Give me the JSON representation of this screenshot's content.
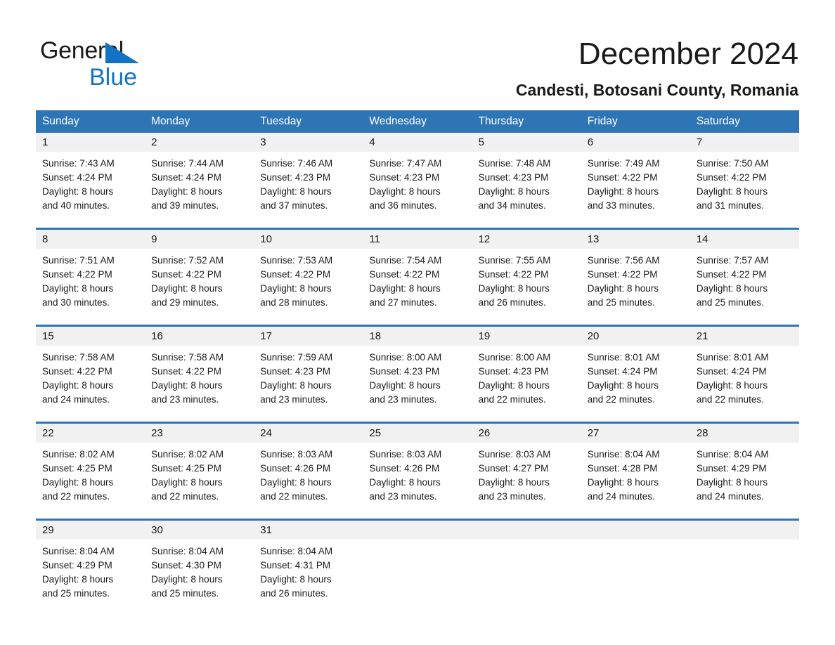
{
  "logo": {
    "word1": "General",
    "word2": "Blue",
    "triangle_color": "#1273c4",
    "icon": "triangle-flag-icon"
  },
  "header": {
    "month_title": "December 2024",
    "location": "Candesti, Botosani County, Romania"
  },
  "colors": {
    "header_blue": "#2e75b6",
    "daynum_band": "#f1f1f1",
    "text": "#1a1a1a",
    "page_background": "#ffffff"
  },
  "calendar": {
    "weekday_headers": [
      "Sunday",
      "Monday",
      "Tuesday",
      "Wednesday",
      "Thursday",
      "Friday",
      "Saturday"
    ],
    "weeks": [
      {
        "daynums": [
          "1",
          "2",
          "3",
          "4",
          "5",
          "6",
          "7"
        ],
        "days": [
          {
            "sunrise": "Sunrise: 7:43 AM",
            "sunset": "Sunset: 4:24 PM",
            "daylight1": "Daylight: 8 hours",
            "daylight2": "and 40 minutes."
          },
          {
            "sunrise": "Sunrise: 7:44 AM",
            "sunset": "Sunset: 4:24 PM",
            "daylight1": "Daylight: 8 hours",
            "daylight2": "and 39 minutes."
          },
          {
            "sunrise": "Sunrise: 7:46 AM",
            "sunset": "Sunset: 4:23 PM",
            "daylight1": "Daylight: 8 hours",
            "daylight2": "and 37 minutes."
          },
          {
            "sunrise": "Sunrise: 7:47 AM",
            "sunset": "Sunset: 4:23 PM",
            "daylight1": "Daylight: 8 hours",
            "daylight2": "and 36 minutes."
          },
          {
            "sunrise": "Sunrise: 7:48 AM",
            "sunset": "Sunset: 4:23 PM",
            "daylight1": "Daylight: 8 hours",
            "daylight2": "and 34 minutes."
          },
          {
            "sunrise": "Sunrise: 7:49 AM",
            "sunset": "Sunset: 4:22 PM",
            "daylight1": "Daylight: 8 hours",
            "daylight2": "and 33 minutes."
          },
          {
            "sunrise": "Sunrise: 7:50 AM",
            "sunset": "Sunset: 4:22 PM",
            "daylight1": "Daylight: 8 hours",
            "daylight2": "and 31 minutes."
          }
        ]
      },
      {
        "daynums": [
          "8",
          "9",
          "10",
          "11",
          "12",
          "13",
          "14"
        ],
        "days": [
          {
            "sunrise": "Sunrise: 7:51 AM",
            "sunset": "Sunset: 4:22 PM",
            "daylight1": "Daylight: 8 hours",
            "daylight2": "and 30 minutes."
          },
          {
            "sunrise": "Sunrise: 7:52 AM",
            "sunset": "Sunset: 4:22 PM",
            "daylight1": "Daylight: 8 hours",
            "daylight2": "and 29 minutes."
          },
          {
            "sunrise": "Sunrise: 7:53 AM",
            "sunset": "Sunset: 4:22 PM",
            "daylight1": "Daylight: 8 hours",
            "daylight2": "and 28 minutes."
          },
          {
            "sunrise": "Sunrise: 7:54 AM",
            "sunset": "Sunset: 4:22 PM",
            "daylight1": "Daylight: 8 hours",
            "daylight2": "and 27 minutes."
          },
          {
            "sunrise": "Sunrise: 7:55 AM",
            "sunset": "Sunset: 4:22 PM",
            "daylight1": "Daylight: 8 hours",
            "daylight2": "and 26 minutes."
          },
          {
            "sunrise": "Sunrise: 7:56 AM",
            "sunset": "Sunset: 4:22 PM",
            "daylight1": "Daylight: 8 hours",
            "daylight2": "and 25 minutes."
          },
          {
            "sunrise": "Sunrise: 7:57 AM",
            "sunset": "Sunset: 4:22 PM",
            "daylight1": "Daylight: 8 hours",
            "daylight2": "and 25 minutes."
          }
        ]
      },
      {
        "daynums": [
          "15",
          "16",
          "17",
          "18",
          "19",
          "20",
          "21"
        ],
        "days": [
          {
            "sunrise": "Sunrise: 7:58 AM",
            "sunset": "Sunset: 4:22 PM",
            "daylight1": "Daylight: 8 hours",
            "daylight2": "and 24 minutes."
          },
          {
            "sunrise": "Sunrise: 7:58 AM",
            "sunset": "Sunset: 4:22 PM",
            "daylight1": "Daylight: 8 hours",
            "daylight2": "and 23 minutes."
          },
          {
            "sunrise": "Sunrise: 7:59 AM",
            "sunset": "Sunset: 4:23 PM",
            "daylight1": "Daylight: 8 hours",
            "daylight2": "and 23 minutes."
          },
          {
            "sunrise": "Sunrise: 8:00 AM",
            "sunset": "Sunset: 4:23 PM",
            "daylight1": "Daylight: 8 hours",
            "daylight2": "and 23 minutes."
          },
          {
            "sunrise": "Sunrise: 8:00 AM",
            "sunset": "Sunset: 4:23 PM",
            "daylight1": "Daylight: 8 hours",
            "daylight2": "and 22 minutes."
          },
          {
            "sunrise": "Sunrise: 8:01 AM",
            "sunset": "Sunset: 4:24 PM",
            "daylight1": "Daylight: 8 hours",
            "daylight2": "and 22 minutes."
          },
          {
            "sunrise": "Sunrise: 8:01 AM",
            "sunset": "Sunset: 4:24 PM",
            "daylight1": "Daylight: 8 hours",
            "daylight2": "and 22 minutes."
          }
        ]
      },
      {
        "daynums": [
          "22",
          "23",
          "24",
          "25",
          "26",
          "27",
          "28"
        ],
        "days": [
          {
            "sunrise": "Sunrise: 8:02 AM",
            "sunset": "Sunset: 4:25 PM",
            "daylight1": "Daylight: 8 hours",
            "daylight2": "and 22 minutes."
          },
          {
            "sunrise": "Sunrise: 8:02 AM",
            "sunset": "Sunset: 4:25 PM",
            "daylight1": "Daylight: 8 hours",
            "daylight2": "and 22 minutes."
          },
          {
            "sunrise": "Sunrise: 8:03 AM",
            "sunset": "Sunset: 4:26 PM",
            "daylight1": "Daylight: 8 hours",
            "daylight2": "and 22 minutes."
          },
          {
            "sunrise": "Sunrise: 8:03 AM",
            "sunset": "Sunset: 4:26 PM",
            "daylight1": "Daylight: 8 hours",
            "daylight2": "and 23 minutes."
          },
          {
            "sunrise": "Sunrise: 8:03 AM",
            "sunset": "Sunset: 4:27 PM",
            "daylight1": "Daylight: 8 hours",
            "daylight2": "and 23 minutes."
          },
          {
            "sunrise": "Sunrise: 8:04 AM",
            "sunset": "Sunset: 4:28 PM",
            "daylight1": "Daylight: 8 hours",
            "daylight2": "and 24 minutes."
          },
          {
            "sunrise": "Sunrise: 8:04 AM",
            "sunset": "Sunset: 4:29 PM",
            "daylight1": "Daylight: 8 hours",
            "daylight2": "and 24 minutes."
          }
        ]
      },
      {
        "daynums": [
          "29",
          "30",
          "31",
          "",
          "",
          "",
          ""
        ],
        "days": [
          {
            "sunrise": "Sunrise: 8:04 AM",
            "sunset": "Sunset: 4:29 PM",
            "daylight1": "Daylight: 8 hours",
            "daylight2": "and 25 minutes."
          },
          {
            "sunrise": "Sunrise: 8:04 AM",
            "sunset": "Sunset: 4:30 PM",
            "daylight1": "Daylight: 8 hours",
            "daylight2": "and 25 minutes."
          },
          {
            "sunrise": "Sunrise: 8:04 AM",
            "sunset": "Sunset: 4:31 PM",
            "daylight1": "Daylight: 8 hours",
            "daylight2": "and 26 minutes."
          },
          {
            "sunrise": "",
            "sunset": "",
            "daylight1": "",
            "daylight2": ""
          },
          {
            "sunrise": "",
            "sunset": "",
            "daylight1": "",
            "daylight2": ""
          },
          {
            "sunrise": "",
            "sunset": "",
            "daylight1": "",
            "daylight2": ""
          },
          {
            "sunrise": "",
            "sunset": "",
            "daylight1": "",
            "daylight2": ""
          }
        ]
      }
    ]
  }
}
